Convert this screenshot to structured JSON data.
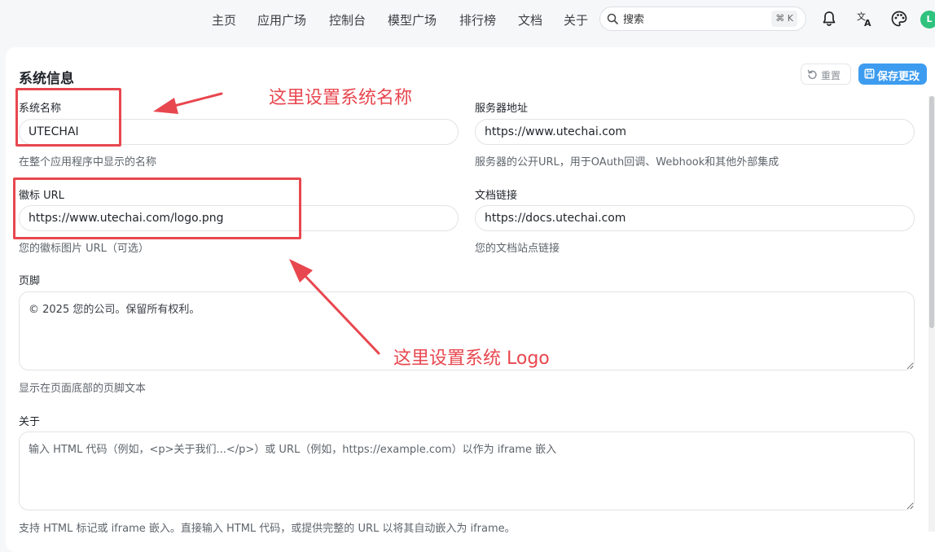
{
  "nav": {
    "items": [
      "主页",
      "应用广场",
      "控制台",
      "模型广场",
      "排行榜",
      "文档",
      "关于"
    ],
    "search_placeholder": "搜索",
    "shortcut": "⌘ K",
    "avatar_initial": "L"
  },
  "page": {
    "title": "系统信息",
    "reset_label": "重置",
    "save_label": "保存更改"
  },
  "fields": {
    "system_name": {
      "label": "系统名称",
      "value": "UTECHAI",
      "hint": "在整个应用程序中显示的名称"
    },
    "server_url": {
      "label": "服务器地址",
      "value": "https://www.utechai.com",
      "hint": "服务器的公开URL，用于OAuth回调、Webhook和其他外部集成"
    },
    "logo_url": {
      "label": "徽标 URL",
      "value": "https://www.utechai.com/logo.png",
      "hint": "您的徽标图片 URL（可选）"
    },
    "docs_link": {
      "label": "文档链接",
      "value": "https://docs.utechai.com",
      "hint": "您的文档站点链接"
    },
    "footer": {
      "label": "页脚",
      "value": "© 2025 您的公司。保留所有权利。",
      "hint": "显示在页面底部的页脚文本"
    },
    "about": {
      "label": "关于",
      "placeholder": "输入 HTML 代码（例如，<p>关于我们...</p>）或 URL（例如，https://example.com）以作为 iframe 嵌入",
      "hint": "支持 HTML 标记或 iframe 嵌入。直接输入 HTML 代码，或提供完整的 URL 以将其自动嵌入为 iframe。"
    }
  },
  "annotations": {
    "name_note": "这里设置系统名称",
    "logo_note": "这里设置系统 Logo",
    "color": "#e8474f"
  },
  "colors": {
    "accent": "#3d9cf0",
    "avatar": "#2ec27e"
  }
}
